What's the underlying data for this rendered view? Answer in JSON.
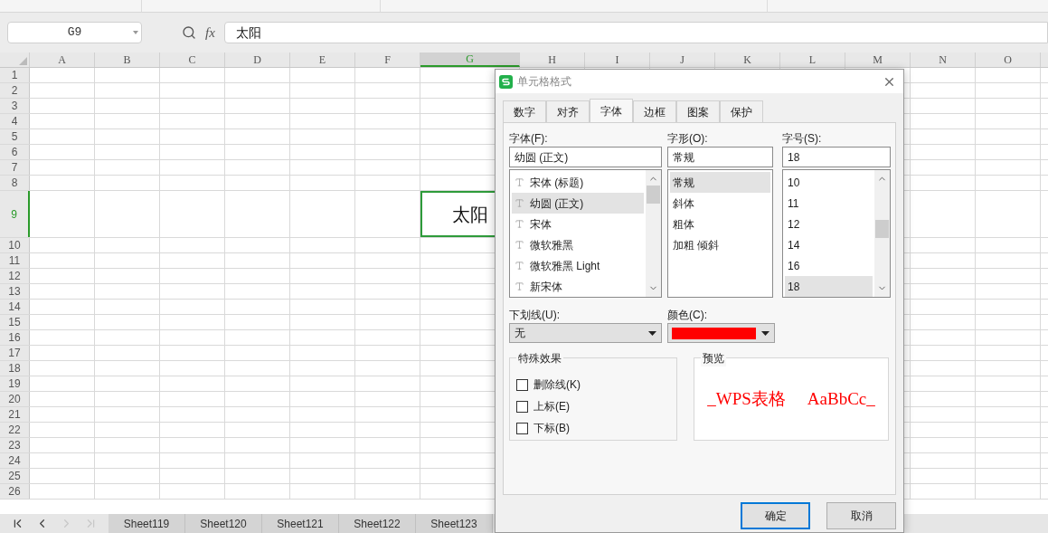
{
  "name_box": {
    "value": "G9"
  },
  "formula_bar": {
    "fx": "fx",
    "value": "太阳"
  },
  "columns": [
    {
      "label": "A",
      "selected": false
    },
    {
      "label": "B",
      "selected": false
    },
    {
      "label": "C",
      "selected": false
    },
    {
      "label": "D",
      "selected": false
    },
    {
      "label": "E",
      "selected": false
    },
    {
      "label": "F",
      "selected": false
    },
    {
      "label": "G",
      "selected": true
    },
    {
      "label": "H",
      "selected": false
    },
    {
      "label": "I",
      "selected": false
    },
    {
      "label": "J",
      "selected": false
    },
    {
      "label": "K",
      "selected": false
    },
    {
      "label": "L",
      "selected": false
    },
    {
      "label": "M",
      "selected": false
    },
    {
      "label": "N",
      "selected": false
    },
    {
      "label": "O",
      "selected": false
    }
  ],
  "rows": [
    {
      "label": "1",
      "selected": false
    },
    {
      "label": "2",
      "selected": false
    },
    {
      "label": "3",
      "selected": false
    },
    {
      "label": "4",
      "selected": false
    },
    {
      "label": "5",
      "selected": false
    },
    {
      "label": "6",
      "selected": false
    },
    {
      "label": "7",
      "selected": false
    },
    {
      "label": "8",
      "selected": false
    },
    {
      "label": "9",
      "selected": true,
      "value": "太阳"
    },
    {
      "label": "10",
      "selected": false
    },
    {
      "label": "11",
      "selected": false
    },
    {
      "label": "12",
      "selected": false
    },
    {
      "label": "13",
      "selected": false
    },
    {
      "label": "14",
      "selected": false
    },
    {
      "label": "15",
      "selected": false
    },
    {
      "label": "16",
      "selected": false
    },
    {
      "label": "17",
      "selected": false
    },
    {
      "label": "18",
      "selected": false
    },
    {
      "label": "19",
      "selected": false
    },
    {
      "label": "20",
      "selected": false
    },
    {
      "label": "21",
      "selected": false
    },
    {
      "label": "22",
      "selected": false
    },
    {
      "label": "23",
      "selected": false
    },
    {
      "label": "24",
      "selected": false
    },
    {
      "label": "25",
      "selected": false
    },
    {
      "label": "26",
      "selected": false
    }
  ],
  "sheet_nav": [
    {
      "kind": "first",
      "disabled": false
    },
    {
      "kind": "prev",
      "disabled": false
    },
    {
      "kind": "next",
      "disabled": true
    },
    {
      "kind": "last",
      "disabled": true
    }
  ],
  "sheet_tabs": [
    {
      "label": "Sheet119",
      "selected": false
    },
    {
      "label": "Sheet120",
      "selected": false
    },
    {
      "label": "Sheet121",
      "selected": false
    },
    {
      "label": "Sheet122",
      "selected": false
    },
    {
      "label": "Sheet123",
      "selected": false
    }
  ],
  "dialog": {
    "title": "单元格格式",
    "tabs": [
      {
        "label": "数字",
        "selected": false
      },
      {
        "label": "对齐",
        "selected": false
      },
      {
        "label": "字体",
        "selected": true
      },
      {
        "label": "边框",
        "selected": false
      },
      {
        "label": "图案",
        "selected": false
      },
      {
        "label": "保护",
        "selected": false
      }
    ],
    "font": {
      "label": "字体(F):",
      "value": "幼圆 (正文)",
      "items": [
        {
          "label": "宋体 (标题)",
          "selected": false
        },
        {
          "label": "幼圆 (正文)",
          "selected": true
        },
        {
          "label": "宋体",
          "selected": false
        },
        {
          "label": "微软雅黑",
          "selected": false
        },
        {
          "label": "微软雅黑 Light",
          "selected": false
        },
        {
          "label": "新宋体",
          "selected": false
        }
      ]
    },
    "style": {
      "label": "字形(O):",
      "value": "常规",
      "items": [
        {
          "label": "常规",
          "selected": true
        },
        {
          "label": "斜体",
          "selected": false
        },
        {
          "label": "粗体",
          "selected": false
        },
        {
          "label": "加粗 倾斜",
          "selected": false
        }
      ]
    },
    "size": {
      "label": "字号(S):",
      "value": "18",
      "items": [
        {
          "label": "10",
          "selected": false
        },
        {
          "label": "11",
          "selected": false
        },
        {
          "label": "12",
          "selected": false
        },
        {
          "label": "14",
          "selected": false
        },
        {
          "label": "16",
          "selected": false
        },
        {
          "label": "18",
          "selected": true
        }
      ]
    },
    "underline": {
      "label": "下划线(U):",
      "value": "无"
    },
    "color": {
      "label": "颜色(C):",
      "color": "#ff0000"
    },
    "effects": {
      "title": "特殊效果",
      "items": [
        {
          "label": "删除线(K)",
          "checked": false
        },
        {
          "label": "上标(E)",
          "checked": false
        },
        {
          "label": "下标(B)",
          "checked": false
        }
      ]
    },
    "preview": {
      "title": "预览",
      "text": "_WPS表格",
      "sample": "AaBbCc_",
      "color": "#ff0000"
    },
    "buttons": [
      {
        "label": "确定",
        "selected": true
      },
      {
        "label": "取消",
        "selected": false
      }
    ]
  }
}
